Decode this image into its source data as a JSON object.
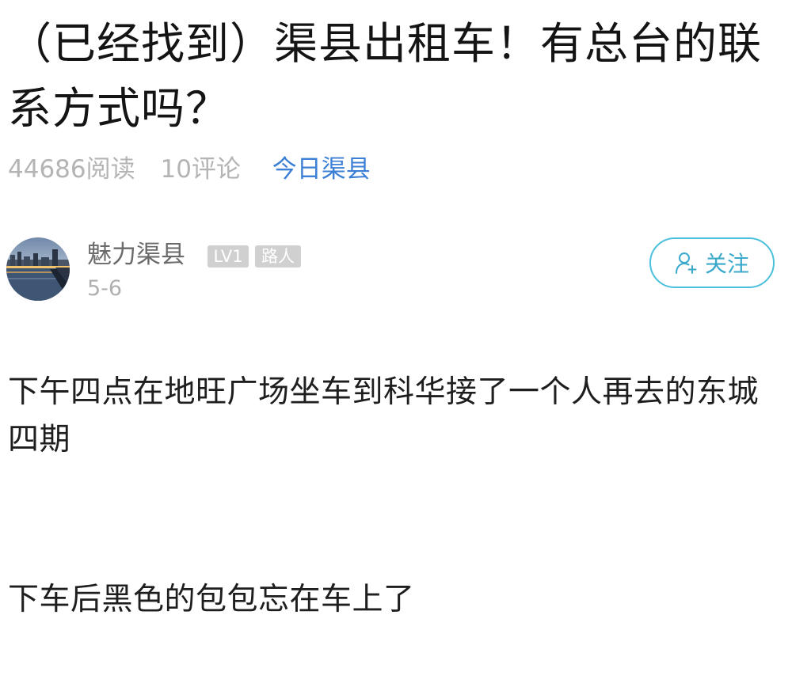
{
  "post": {
    "title": "（已经找到）渠县出租车！有总台的联系方式吗？",
    "views": "44686阅读",
    "comments": "10评论",
    "board": "今日渠县"
  },
  "author": {
    "name": "魅力渠县",
    "level": "LV1",
    "role": "路人",
    "date": "5-6",
    "avatar_icon": "avatar-photo-riverside-city"
  },
  "follow": {
    "label": "关注",
    "icon": "add-user-icon",
    "color": "#3aa9cc"
  },
  "content": {
    "paragraphs": [
      "下午四点在地旺广场坐车到科华接了一个人再去的东城四期",
      "下车后黑色的包包忘在车上了"
    ]
  },
  "colors": {
    "meta_gray": "#b4b4b4",
    "board_blue": "#3b7fd6",
    "badge_gray": "#d0d0d0"
  }
}
